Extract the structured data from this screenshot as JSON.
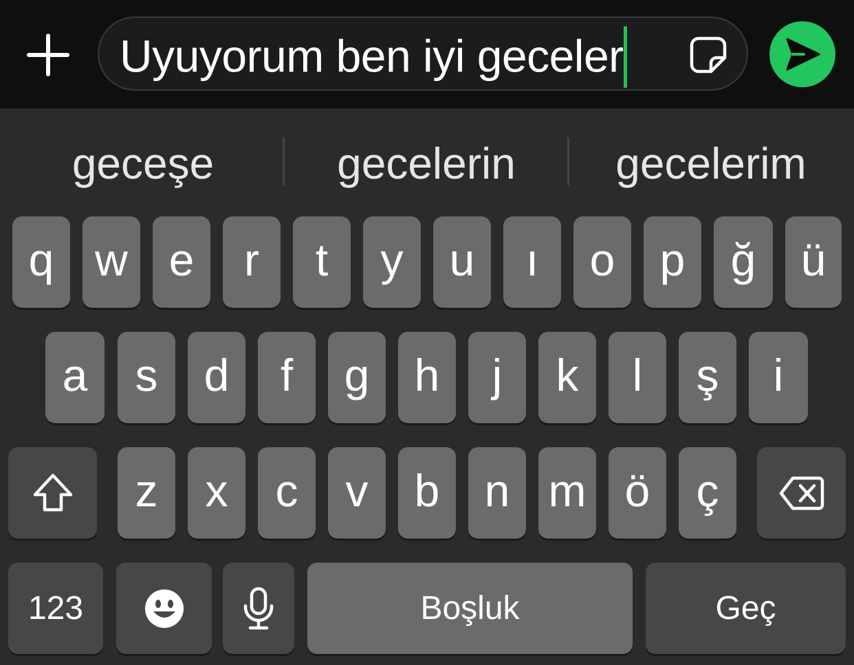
{
  "compose": {
    "message_text": "Uyuyorum ben iyi geceler",
    "accent_color": "#22c55e",
    "icons": {
      "attach": "plus-icon",
      "sticker": "sticker-icon",
      "send": "send-icon"
    }
  },
  "suggestions": [
    "geceşe",
    "gecelerin",
    "gecelerim"
  ],
  "keyboard": {
    "row1": [
      "q",
      "w",
      "e",
      "r",
      "t",
      "y",
      "u",
      "ı",
      "o",
      "p",
      "ğ",
      "ü"
    ],
    "row2": [
      "a",
      "s",
      "d",
      "f",
      "g",
      "h",
      "j",
      "k",
      "l",
      "ş",
      "i"
    ],
    "row3": [
      "z",
      "x",
      "c",
      "v",
      "b",
      "n",
      "m",
      "ö",
      "ç"
    ],
    "shift_icon": "shift-arrow-icon",
    "backspace_icon": "backspace-icon",
    "numbers_label": "123",
    "emoji_icon": "emoji-icon",
    "mic_icon": "microphone-icon",
    "space_label": "Boşluk",
    "return_label": "Geç"
  }
}
